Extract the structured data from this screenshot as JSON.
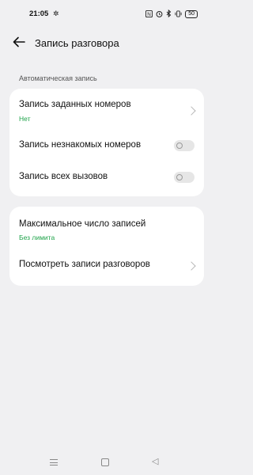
{
  "status_bar": {
    "time": "21:05",
    "icons": [
      "settings-gear-icon",
      "nfc-icon",
      "alarm-icon",
      "bluetooth-icon",
      "vibrate-icon"
    ],
    "battery": "50"
  },
  "header": {
    "title": "Запись разговора"
  },
  "section_label": "Автоматическая запись",
  "card1": {
    "row1": {
      "title": "Запись заданных номеров",
      "subtitle": "Нет"
    },
    "row2": {
      "title": "Запись незнакомых номеров",
      "toggle_on": false
    },
    "row3": {
      "title": "Запись всех вызовов",
      "toggle_on": false
    }
  },
  "card2": {
    "row1": {
      "title": "Максимальное число записей",
      "subtitle": "Без лимита"
    },
    "row2": {
      "title": "Посмотреть записи разговоров"
    }
  },
  "colors": {
    "background": "#f0f0f2",
    "card": "#ffffff",
    "accent_green": "#1fa34a"
  }
}
